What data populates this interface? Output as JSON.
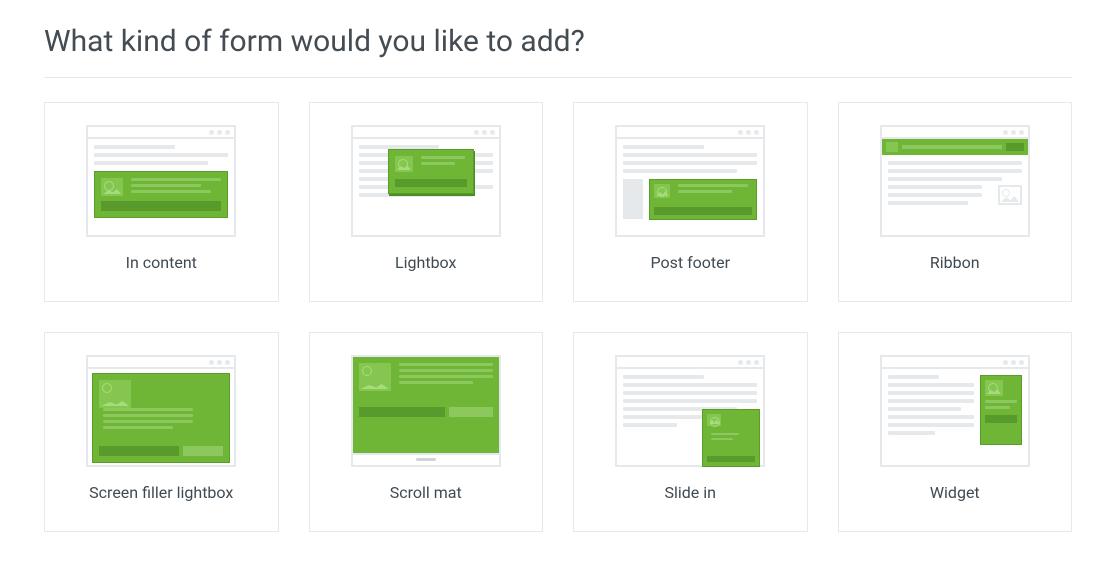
{
  "heading": "What kind of form would you like to add?",
  "options": [
    {
      "label": "In content"
    },
    {
      "label": "Lightbox"
    },
    {
      "label": "Post footer"
    },
    {
      "label": "Ribbon"
    },
    {
      "label": "Screen filler lightbox"
    },
    {
      "label": "Scroll mat"
    },
    {
      "label": "Slide in"
    },
    {
      "label": "Widget"
    }
  ]
}
